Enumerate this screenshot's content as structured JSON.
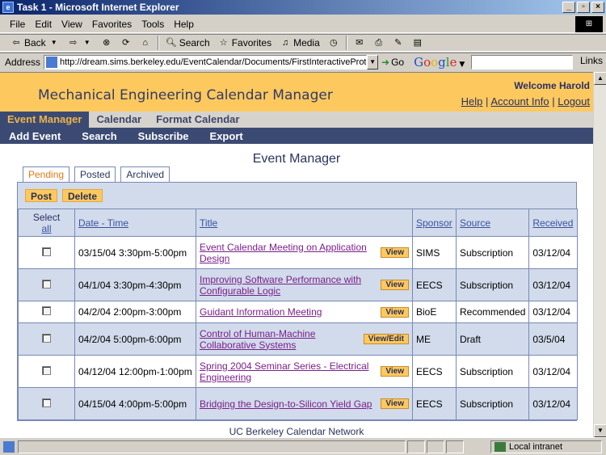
{
  "window": {
    "title": "Task 1 - Microsoft Internet Explorer",
    "controls": [
      "_",
      "▫",
      "×"
    ]
  },
  "menu": [
    "File",
    "Edit",
    "View",
    "Favorites",
    "Tools",
    "Help"
  ],
  "toolbar": {
    "back": "Back",
    "search": "Search",
    "favorites": "Favorites",
    "media": "Media"
  },
  "address": {
    "label": "Address",
    "url": "http://dream.sims.berkeley.edu/EventCalendar/Documents/FirstInteractiveProtc",
    "go": "Go",
    "links": "Links"
  },
  "app": {
    "title": "Mechanical Engineering Calendar Manager",
    "welcome": "Welcome Harold",
    "top_links": [
      "Help",
      "Account Info",
      "Logout"
    ],
    "nav_tabs": [
      "Event Manager",
      "Calendar",
      "Format Calendar"
    ],
    "sub_nav": [
      "Add Event",
      "Search",
      "Subscribe",
      "Export"
    ],
    "page_title": "Event Manager",
    "status_tabs": [
      "Pending",
      "Posted",
      "Archived"
    ],
    "actions": [
      "Post",
      "Delete"
    ],
    "columns": {
      "select": "Select",
      "select_all": "all",
      "date_time": "Date - Time",
      "title": "Title",
      "sponsor": "Sponsor",
      "source": "Source",
      "received": "Received"
    },
    "events": [
      {
        "date_time": "03/15/04 3:30pm-5:00pm",
        "title": "Event Calendar Meeting on Application Design",
        "button": "View",
        "sponsor": "SIMS",
        "source": "Subscription",
        "received": "03/12/04"
      },
      {
        "date_time": "04/1/04 3:30pm-4:30pm",
        "title": "Improving Software Performance with Configurable Logic",
        "button": "View",
        "sponsor": "EECS",
        "source": "Subscription",
        "received": "03/12/04"
      },
      {
        "date_time": "04/2/04 2:00pm-3:00pm",
        "title": "Guidant Information Meeting",
        "button": "View",
        "sponsor": "BioE",
        "source": "Recommended",
        "received": "03/12/04"
      },
      {
        "date_time": "04/2/04 5:00pm-6:00pm",
        "title": "Control of Human-Machine Collaborative Systems",
        "button": "View/Edit",
        "sponsor": "ME",
        "source": "Draft",
        "received": "03/5/04"
      },
      {
        "date_time": "04/12/04 12:00pm-1:00pm",
        "title": "Spring 2004 Seminar Series - Electrical Engineering",
        "button": "View",
        "sponsor": "EECS",
        "source": "Subscription",
        "received": "03/12/04"
      },
      {
        "date_time": "04/15/04 4:00pm-5:00pm",
        "title": "Bridging the Design-to-Silicon Yield Gap",
        "button": "View",
        "sponsor": "EECS",
        "source": "Subscription",
        "received": "03/12/04"
      }
    ],
    "footer": "UC Berkeley Calendar Network"
  },
  "status": {
    "zone": "Local intranet"
  }
}
